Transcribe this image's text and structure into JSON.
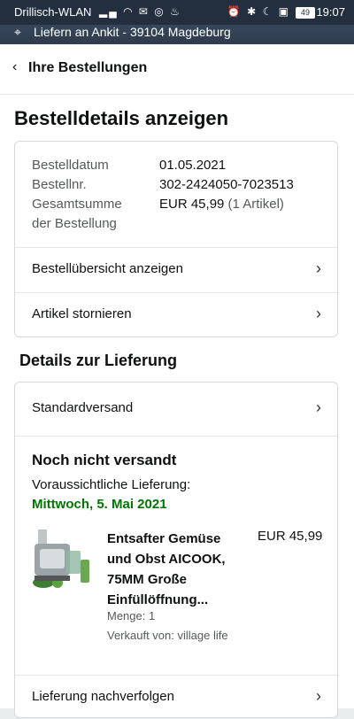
{
  "status_bar": {
    "carrier": "Drillisch-WLAN",
    "battery": "49",
    "time": "19:07"
  },
  "location_bar": {
    "text": "Liefern an Ankit - 39104 Magdeburg"
  },
  "breadcrumb": {
    "label": "Ihre Bestellungen"
  },
  "page": {
    "title": "Bestelldetails anzeigen"
  },
  "order_info": {
    "date_label": "Bestelldatum",
    "date_value": "01.05.2021",
    "number_label": "Bestellnr.",
    "number_value": "302-2424050-7023513",
    "total_label_line1": "Gesamtsumme",
    "total_label_line2": "der Bestellung",
    "total_value": "EUR 45,99",
    "total_items": "(1 Artikel)"
  },
  "order_actions": {
    "summary_label": "Bestellübersicht anzeigen",
    "cancel_label": "Artikel stornieren"
  },
  "delivery": {
    "section_title": "Details zur Lieferung",
    "shipping_method": "Standardversand",
    "status": "Noch nicht versandt",
    "expected_label": "Voraussichtliche Lieferung:",
    "expected_date": "Mittwoch, 5. Mai 2021",
    "track_label": "Lieferung nachverfolgen"
  },
  "product": {
    "title_line1": "Entsafter Gemüse",
    "title_line2": "und Obst AICOOK,",
    "title_line3": "75MM Große",
    "title_line4": "Einfüllöffnung...",
    "price": "EUR 45,99",
    "quantity": "Menge: 1",
    "seller": "Verkauft von: village life"
  },
  "colors": {
    "header_bg": "#232f3e",
    "delivery_green": "#007600"
  }
}
